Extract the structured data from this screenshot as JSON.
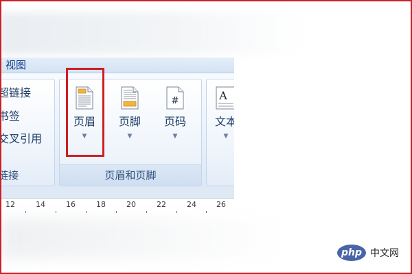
{
  "ribbon": {
    "tab_view": "视图",
    "links_group": {
      "items": [
        "超链接",
        "书签",
        "交叉引用"
      ],
      "footer": "链接"
    },
    "header_footer_group": {
      "buttons": [
        {
          "label": "页眉",
          "icon": "header-icon",
          "highlighted": true
        },
        {
          "label": "页脚",
          "icon": "footer-icon",
          "highlighted": false
        },
        {
          "label": "页码",
          "icon": "page-number-icon",
          "highlighted": false
        }
      ],
      "footer": "页眉和页脚"
    },
    "text_group": {
      "button": {
        "label": "文本",
        "icon": "text-box-icon"
      }
    }
  },
  "ruler": {
    "ticks": [
      "12",
      "14",
      "16",
      "18",
      "20",
      "22",
      "24",
      "26"
    ]
  },
  "watermark": {
    "logo": "php",
    "text": "中文网"
  },
  "colors": {
    "highlight": "#cc1f24",
    "accent_text": "#15428b",
    "ribbon_bg": "#e7f0fa"
  }
}
